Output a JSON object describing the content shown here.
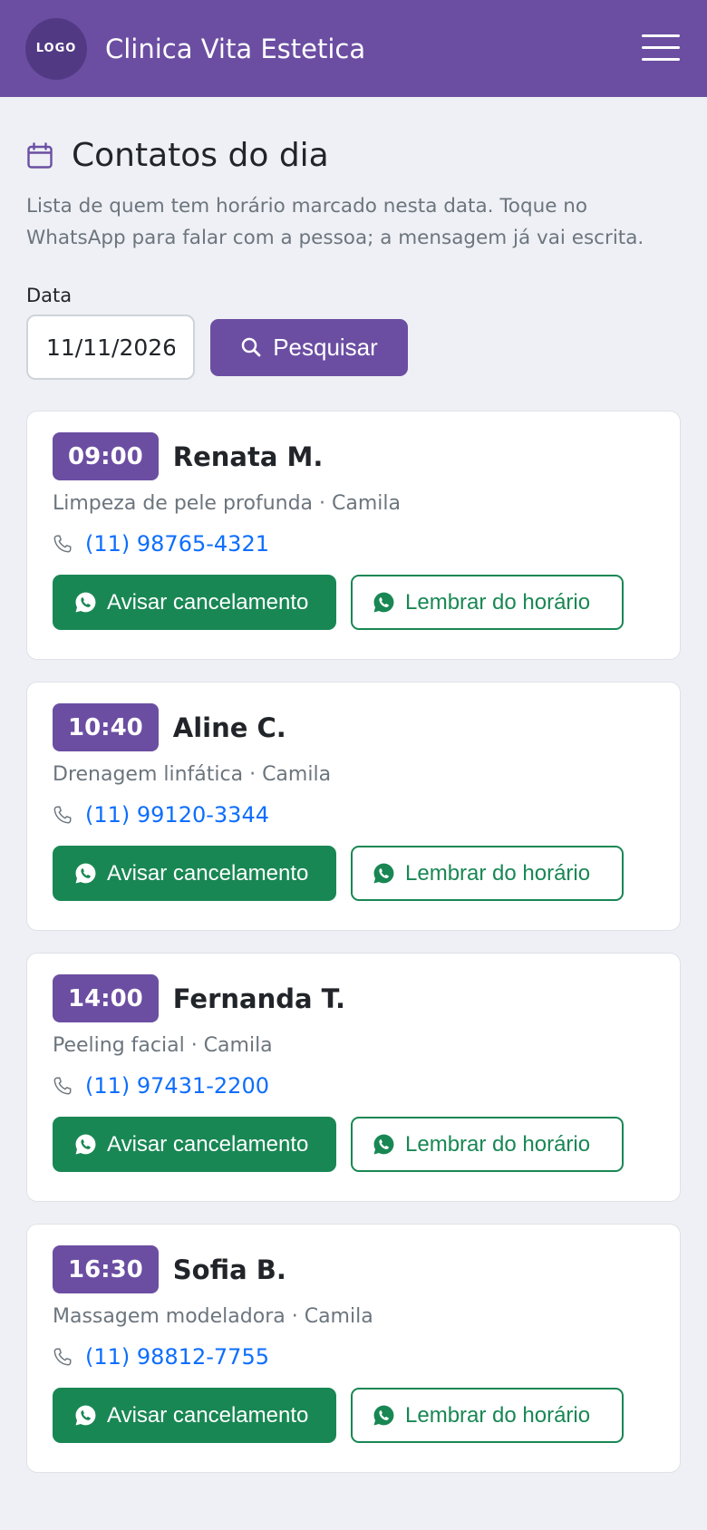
{
  "navbar": {
    "logo_text": "LOGO",
    "brand": "Clinica Vita Estetica",
    "menu_icon": "hamburger-menu-icon"
  },
  "page": {
    "icon": "calendar-icon",
    "title": "Contatos do dia",
    "description": "Lista de quem tem horário marcado nesta data. Toque no WhatsApp para falar com a pessoa; a mensagem já vai escrita."
  },
  "form": {
    "date_label": "Data",
    "date_value": "11/11/2026",
    "search_label": "Pesquisar",
    "search_icon": "search-icon"
  },
  "appointments": [
    {
      "time": "09:00",
      "name": "Renata M.",
      "service": "Limpeza de pele profunda · Camila",
      "phone": "(11) 98765-4321",
      "cancel_label": "Avisar cancelamento",
      "remind_label": "Lembrar do horário"
    },
    {
      "time": "10:40",
      "name": "Aline C.",
      "service": "Drenagem linfática · Camila",
      "phone": "(11) 99120-3344",
      "cancel_label": "Avisar cancelamento",
      "remind_label": "Lembrar do horário"
    },
    {
      "time": "14:00",
      "name": "Fernanda T.",
      "service": "Peeling facial · Camila",
      "phone": "(11) 97431-2200",
      "cancel_label": "Avisar cancelamento",
      "remind_label": "Lembrar do horário"
    },
    {
      "time": "16:30",
      "name": "Sofia B.",
      "service": "Massagem modeladora · Camila",
      "phone": "(11) 98812-7755",
      "cancel_label": "Avisar cancelamento",
      "remind_label": "Lembrar do horário"
    }
  ],
  "colors": {
    "brand_purple": "#6b4ea2",
    "whatsapp_green": "#198754",
    "link_blue": "#0d6efd",
    "background": "#eef0f5"
  }
}
